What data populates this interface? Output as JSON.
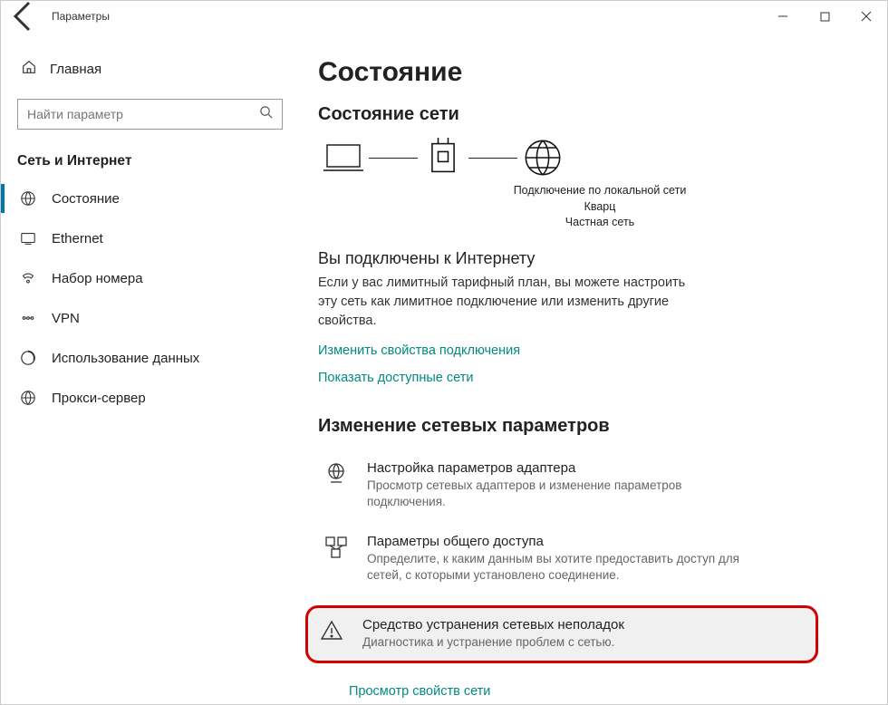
{
  "window": {
    "title": "Параметры"
  },
  "sidebar": {
    "home_label": "Главная",
    "search_placeholder": "Найти параметр",
    "section_title": "Сеть и Интернет",
    "items": [
      {
        "label": "Состояние"
      },
      {
        "label": "Ethernet"
      },
      {
        "label": "Набор номера"
      },
      {
        "label": "VPN"
      },
      {
        "label": "Использование данных"
      },
      {
        "label": "Прокси-сервер"
      }
    ]
  },
  "content": {
    "page_title": "Состояние",
    "status_section_title": "Состояние сети",
    "diagram_caption_line1": "Подключение по локальной сети",
    "diagram_caption_line2": "Кварц",
    "diagram_caption_line3": "Частная сеть",
    "connected_heading": "Вы подключены к Интернету",
    "connected_desc": "Если у вас лимитный тарифный план, вы можете настроить эту сеть как лимитное подключение или изменить другие свойства.",
    "link_change_props": "Изменить свойства подключения",
    "link_show_nets": "Показать доступные сети",
    "change_section_title": "Изменение сетевых параметров",
    "options": [
      {
        "title": "Настройка параметров адаптера",
        "desc": "Просмотр сетевых адаптеров и изменение параметров подключения."
      },
      {
        "title": "Параметры общего доступа",
        "desc": "Определите, к каким данным вы хотите предоставить доступ для сетей, с которыми установлено соединение."
      },
      {
        "title": "Средство устранения сетевых неполадок",
        "desc": "Диагностика и устранение проблем с сетью."
      }
    ],
    "link_view_props": "Просмотр свойств сети"
  }
}
